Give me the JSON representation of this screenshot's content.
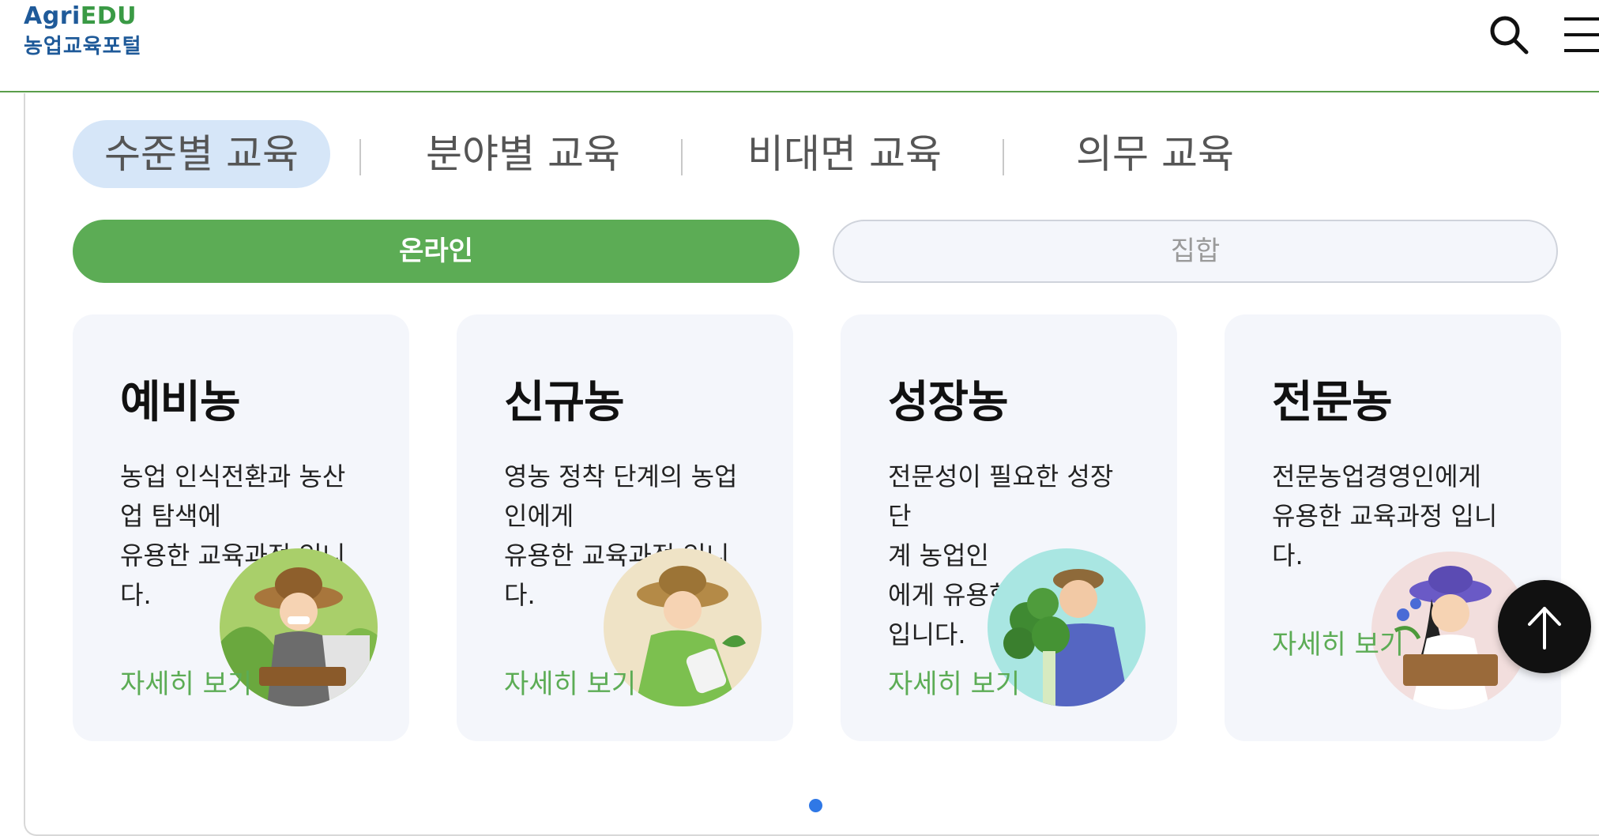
{
  "header": {
    "logo_agri": "Agri",
    "logo_edu": "EDU",
    "logo_sub": "농업교육포털",
    "search_icon": "search-icon",
    "menu_icon": "hamburger-menu-icon"
  },
  "tabs": [
    {
      "label": "수준별 교육",
      "active": true
    },
    {
      "label": "분야별 교육",
      "active": false
    },
    {
      "label": "비대면 교육",
      "active": false
    },
    {
      "label": "의무 교육",
      "active": false
    }
  ],
  "mode": {
    "online_label": "온라인",
    "offline_label": "집합",
    "selected": "온라인"
  },
  "cards": [
    {
      "title": "예비농",
      "desc_lines": [
        "농업 인식전환과 농산",
        "업 탐색에",
        "유용한 교육과정 입니",
        "다."
      ],
      "link": "자세히 보기",
      "image": "farmer-with-hat-holding-plant-box"
    },
    {
      "title": "신규농",
      "desc_lines": [
        "영농 정착 단계의 농업",
        "인에게",
        "유용한 교육과정 입니",
        "다."
      ],
      "link": "자세히 보기",
      "image": "farmer-bending-with-seedling"
    },
    {
      "title": "성장농",
      "desc_lines": [
        "전문성이 필요한 성장 단",
        "계 농업인",
        "에게 유용한 교육과정",
        "입니다."
      ],
      "link": "자세히 보기",
      "image": "farmer-holding-greens-bundle"
    },
    {
      "title": "전문농",
      "desc_lines": [
        "전문농업경영인에게",
        "유용한 교육과정 입니",
        "다."
      ],
      "link": "자세히 보기",
      "image": "farmer-woman-holding-flower-crate"
    }
  ],
  "scroll_top_icon": "arrow-up-icon",
  "pagination": {
    "current": 1,
    "total": 1
  },
  "colors": {
    "brand_blue": "#1f5a99",
    "brand_green": "#3a9a45",
    "accent_green": "#5cac55",
    "tab_active_bg": "#d6e6f8",
    "card_bg": "#f4f6fb",
    "pager_dot": "#2f78e6"
  }
}
